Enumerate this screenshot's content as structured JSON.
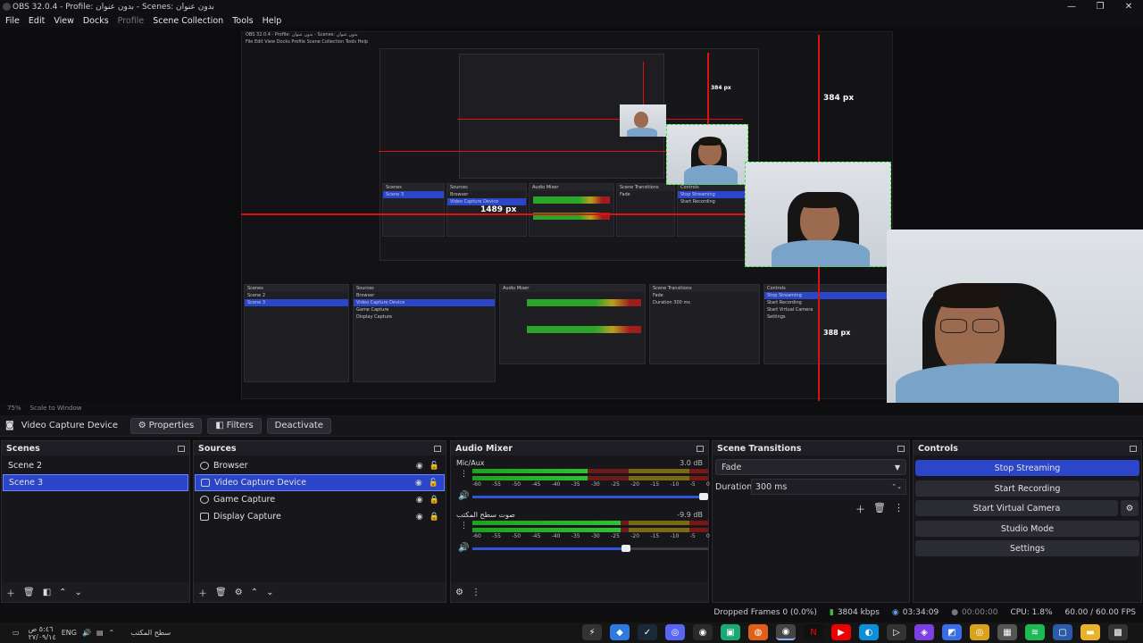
{
  "window": {
    "title": "OBS 32.0.4 - Profile: بدون عنوان - Scenes: بدون عنوان"
  },
  "menu": [
    "File",
    "Edit",
    "View",
    "Docks",
    "Profile",
    "Scene Collection",
    "Tools",
    "Help"
  ],
  "preview": {
    "labels": {
      "a": "384 px",
      "b": "384 px",
      "c": "1489 px",
      "d": "388 px"
    },
    "nested_menu": "File  Edit  View  Docks  Profile  Scene Collection  Tools  Help"
  },
  "scale": {
    "zoom": "75%",
    "mode": "Scale to Window"
  },
  "source_bar": {
    "name": "Video Capture Device",
    "properties": "Properties",
    "filters": "Filters",
    "deactivate": "Deactivate"
  },
  "scenes": {
    "title": "Scenes",
    "items": [
      "Scene 2",
      "Scene 3"
    ],
    "selected": 1
  },
  "sources": {
    "title": "Sources",
    "items": [
      {
        "name": "Browser",
        "icon": "globe-icon"
      },
      {
        "name": "Video Capture Device",
        "icon": "camera-icon"
      },
      {
        "name": "Game Capture",
        "icon": "gamepad-icon"
      },
      {
        "name": "Display Capture",
        "icon": "monitor-icon"
      }
    ],
    "selected": 1
  },
  "mixer": {
    "title": "Audio Mixer",
    "channels": [
      {
        "name": "Mic/Aux",
        "db": "3.0 dB",
        "level": 0.49,
        "peak": 0.67,
        "volume": 0.98
      },
      {
        "name": "صوت سطح المكتب",
        "db": "-9.9 dB",
        "level": 0.63,
        "peak": 0.63,
        "volume": 0.65
      }
    ],
    "ticks": [
      "-60",
      "-55",
      "-50",
      "-45",
      "-40",
      "-35",
      "-30",
      "-25",
      "-20",
      "-15",
      "-10",
      "-5",
      "0"
    ]
  },
  "transitions": {
    "title": "Scene Transitions",
    "type": "Fade",
    "duration_label": "Duration",
    "duration": "300 ms"
  },
  "controls": {
    "title": "Controls",
    "buttons": [
      "Stop Streaming",
      "Start Recording",
      "Start Virtual Camera",
      "Studio Mode",
      "Settings"
    ]
  },
  "status": {
    "dropped": "Dropped Frames 0 (0.0%)",
    "bitrate": "3804 kbps",
    "stream_time": "03:34:09",
    "rec_time": "00:00:00",
    "cpu": "CPU: 1.8%",
    "fps": "60.00 / 60.00 FPS"
  },
  "taskbar": {
    "time": "٥:٤٦ ص",
    "date": "٢٧/٠٩/١٤",
    "lang": "ENG",
    "desktop": "سطح المكتب"
  }
}
